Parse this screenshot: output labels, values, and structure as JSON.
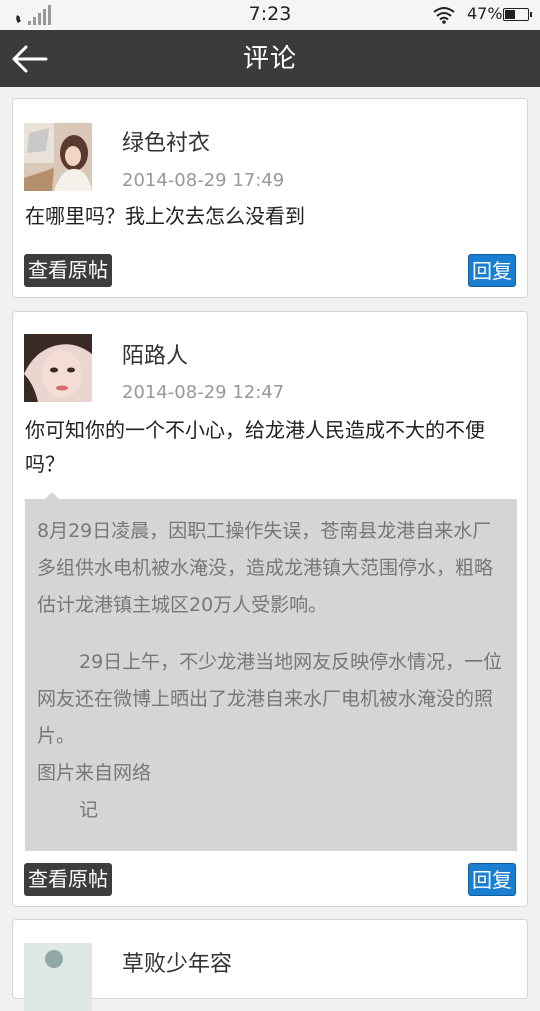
{
  "status_bar": {
    "time": "7:23",
    "battery_text": "47%",
    "battery_level": 0.47
  },
  "header": {
    "title": "评论"
  },
  "comments": [
    {
      "username": "绿色衬衣",
      "timestamp": "2014-08-29 17:49",
      "text": "在哪里吗？我上次去怎么没看到",
      "view_original_label": "查看原帖",
      "reply_label": "回复"
    },
    {
      "username": "陌路人",
      "timestamp": "2014-08-29 12:47",
      "text": "你可知你的一个不小心，给龙港人民造成不大的不便吗？",
      "quote": {
        "p1": "8月29日凌晨，因职工操作失误，苍南县龙港自来水厂多组供水电机被水淹没，造成龙港镇大范围停水，粗略估计龙港镇主城区20万人受影响。",
        "p2": "29日上午，不少龙港当地网友反映停水情况，一位网友还在微博上晒出了龙港自来水厂电机被水淹没的照片。",
        "p3": "图片来自网络",
        "p4": "记"
      },
      "view_original_label": "查看原帖",
      "reply_label": "回复"
    },
    {
      "username": "草败少年容"
    }
  ]
}
